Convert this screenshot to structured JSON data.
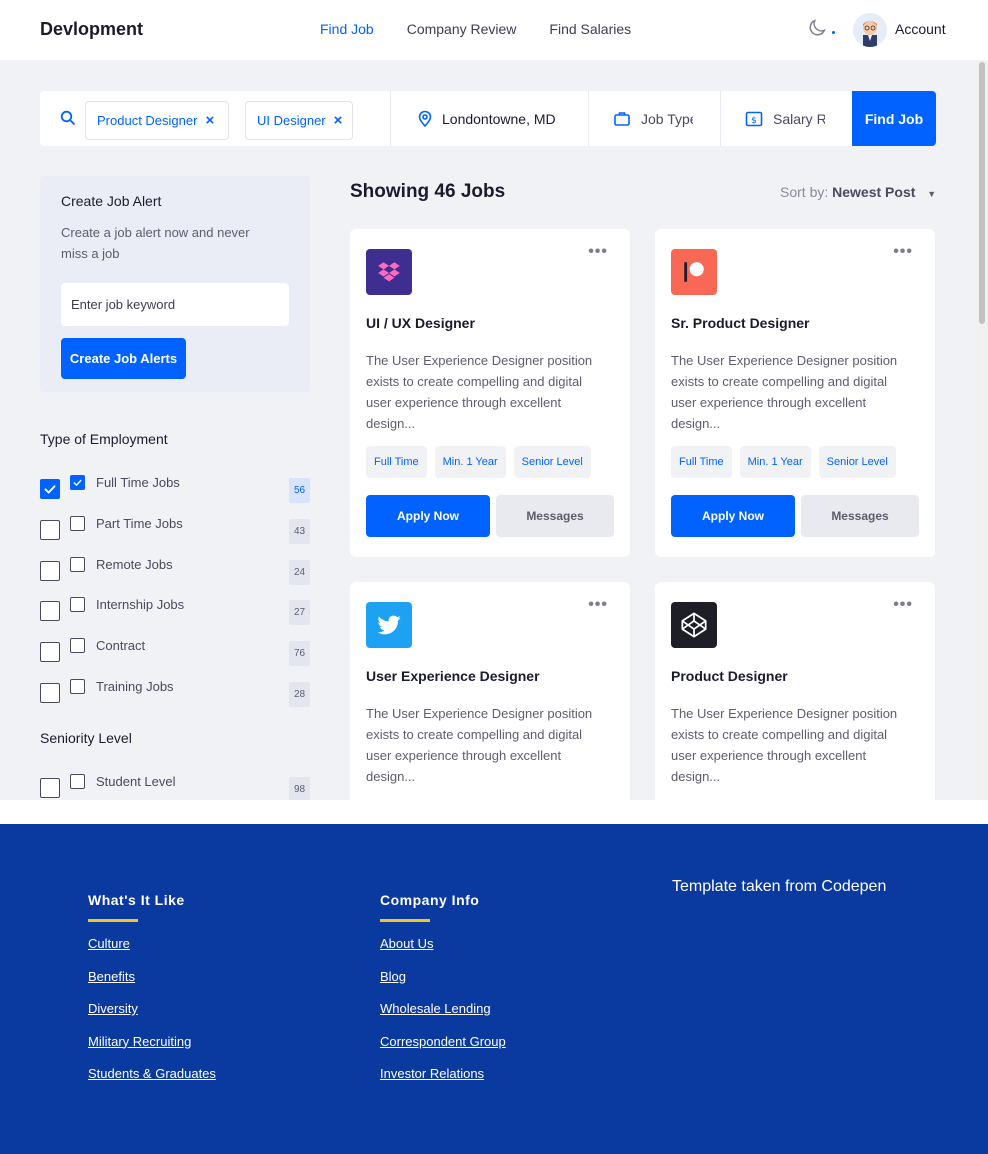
{
  "header": {
    "brand": "Devlopment",
    "nav": [
      "Find Job",
      "Company Review",
      "Find Salaries"
    ],
    "account": "Account"
  },
  "search": {
    "chips": [
      "Product Designer",
      "UI Designer"
    ],
    "chip_close": "×",
    "location": "Londontowne, MD",
    "job_type_placeholder": "Job Type",
    "salary_placeholder": "Salary Range",
    "find_button": "Find Job"
  },
  "sidebar": {
    "alert_title": "Create Job Alert",
    "alert_desc": "Create a job alert now and never miss a job",
    "alert_input_placeholder": "Enter job keyword",
    "alert_button": "Create Job Alerts",
    "employment_title": "Type of Employment",
    "employment": [
      {
        "label": "Full Time Jobs",
        "count": "56",
        "checked": true
      },
      {
        "label": "Part Time Jobs",
        "count": "43",
        "checked": false
      },
      {
        "label": "Remote Jobs",
        "count": "24",
        "checked": false
      },
      {
        "label": "Internship Jobs",
        "count": "27",
        "checked": false
      },
      {
        "label": "Contract",
        "count": "76",
        "checked": false
      },
      {
        "label": "Training Jobs",
        "count": "28",
        "checked": false
      }
    ],
    "seniority_title": "Seniority Level",
    "seniority": [
      {
        "label": "Student Level",
        "count": "98",
        "checked": false
      }
    ]
  },
  "results": {
    "showing": "Showing 46 Jobs",
    "sort_label": "Sort by:",
    "sort_value": "Newest Post",
    "sort_caret": "▼"
  },
  "cards": [
    {
      "title": "UI / UX Designer",
      "logo": "dropbox-icon",
      "logo_color": "#3d2e8f",
      "desc": "The User Experience Designer position exists to create compelling and digital user experience through excellent design...",
      "tags": [
        "Full Time",
        "Min. 1 Year",
        "Senior Level"
      ],
      "apply": "Apply Now",
      "messages": "Messages",
      "more": "•••"
    },
    {
      "title": "Sr. Product Designer",
      "logo": "patreon-icon",
      "logo_color": "#f96854",
      "desc": "The User Experience Designer position exists to create compelling and digital user experience through excellent design...",
      "tags": [
        "Full Time",
        "Min. 1 Year",
        "Senior Level"
      ],
      "apply": "Apply Now",
      "messages": "Messages",
      "more": "•••"
    },
    {
      "title": "User Experience Designer",
      "logo": "twitter-icon",
      "logo_color": "#1da1f2",
      "desc": "The User Experience Designer position exists to create compelling and digital user experience through excellent design...",
      "tags": [],
      "apply": "",
      "messages": "",
      "more": "•••"
    },
    {
      "title": "Product Designer",
      "logo": "codepen-icon",
      "logo_color": "#1e1f26",
      "desc": "The User Experience Designer position exists to create compelling and digital user experience through excellent design...",
      "tags": [],
      "apply": "",
      "messages": "",
      "more": "•••"
    }
  ],
  "footer": {
    "col1_title": "What's It Like",
    "col1_links": [
      "Culture",
      "Benefits",
      "Diversity",
      "Military Recruiting",
      "Students & Graduates"
    ],
    "col2_title": "Company Info",
    "col2_links": [
      "About Us",
      "Blog",
      "Wholesale Lending",
      "Correspondent Group",
      "Investor Relations"
    ],
    "template_note": "Template taken from Codepen",
    "accent_color": "#f5c518",
    "bg_color": "#0a3a9f"
  }
}
